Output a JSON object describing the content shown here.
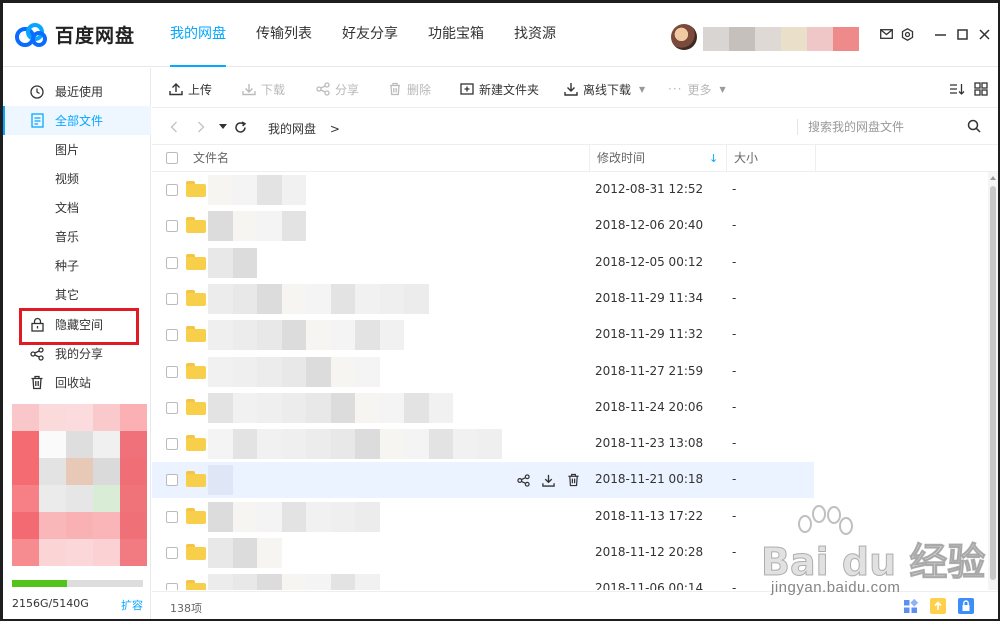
{
  "app": {
    "name": "百度网盘"
  },
  "header": {
    "tabs": [
      {
        "label": "我的网盘",
        "active": true
      },
      {
        "label": "传输列表",
        "active": false
      },
      {
        "label": "好友分享",
        "active": false
      },
      {
        "label": "功能宝箱",
        "active": false
      },
      {
        "label": "找资源",
        "active": false
      }
    ],
    "icons": [
      "mail-icon",
      "settings-icon",
      "minimize-icon",
      "maximize-icon",
      "close-icon"
    ]
  },
  "sidebar": {
    "items": [
      {
        "label": "最近使用",
        "icon": "clock-icon",
        "sub": false,
        "active": false
      },
      {
        "label": "全部文件",
        "icon": "document-icon",
        "sub": false,
        "active": true
      },
      {
        "label": "图片",
        "sub": true,
        "active": false
      },
      {
        "label": "视频",
        "sub": true,
        "active": false
      },
      {
        "label": "文档",
        "sub": true,
        "active": false
      },
      {
        "label": "音乐",
        "sub": true,
        "active": false
      },
      {
        "label": "种子",
        "sub": true,
        "active": false
      },
      {
        "label": "其它",
        "sub": true,
        "active": false
      },
      {
        "label": "隐藏空间",
        "icon": "lock-icon",
        "sub": false,
        "active": false,
        "highlighted": true
      },
      {
        "label": "我的分享",
        "icon": "share-icon",
        "sub": false,
        "active": false
      },
      {
        "label": "回收站",
        "icon": "trash-icon",
        "sub": false,
        "active": false
      }
    ],
    "quota": {
      "text": "2156G/5140G",
      "used_fraction": 0.42,
      "expand_label": "扩容"
    }
  },
  "toolbar": {
    "upload": "上传",
    "download": "下载",
    "share": "分享",
    "delete": "删除",
    "new_folder": "新建文件夹",
    "offline_download": "离线下载",
    "more": "更多"
  },
  "path": {
    "crumb": "我的网盘",
    "separator": ">",
    "search_placeholder": "搜索我的网盘文件"
  },
  "table": {
    "columns": {
      "name": "文件名",
      "modified": "修改时间",
      "size": "大小"
    },
    "rows": [
      {
        "date": "2012-08-31 12:52",
        "size": "-"
      },
      {
        "date": "2018-12-06 20:40",
        "size": "-"
      },
      {
        "date": "2018-12-05 00:12",
        "size": "-"
      },
      {
        "date": "2018-11-29 11:34",
        "size": "-"
      },
      {
        "date": "2018-11-29 11:32",
        "size": "-"
      },
      {
        "date": "2018-11-27 21:59",
        "size": "-"
      },
      {
        "date": "2018-11-24 20:06",
        "size": "-"
      },
      {
        "date": "2018-11-23 13:08",
        "size": "-"
      },
      {
        "date": "2018-11-21 00:18",
        "size": "-",
        "hover": true
      },
      {
        "date": "2018-11-13 17:22",
        "size": "-"
      },
      {
        "date": "2018-11-12 20:28",
        "size": "-"
      },
      {
        "date": "2018-11-06 00:14",
        "size": "-"
      }
    ]
  },
  "footer": {
    "count": "138项"
  },
  "watermark": {
    "brand": "Bai du 经验",
    "url": "jingyan.baidu.com"
  },
  "colors": {
    "accent": "#06a7ff",
    "folder": "#f8cf4b",
    "highlight_box": "#e01b23",
    "quota_fill": "#52c41a"
  }
}
